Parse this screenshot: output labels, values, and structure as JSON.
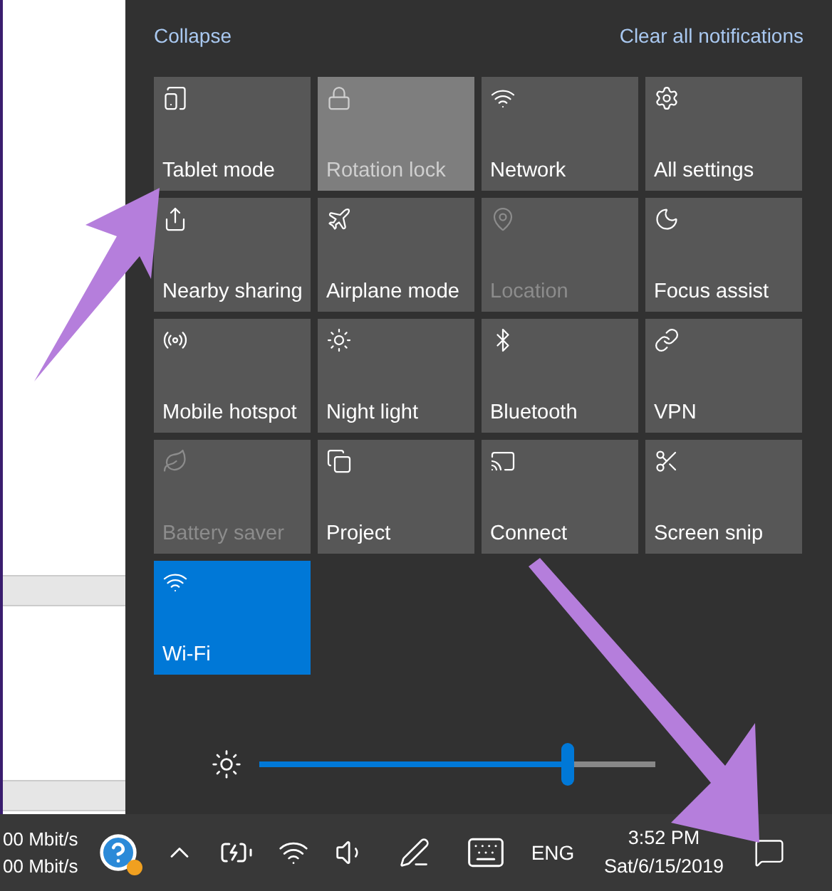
{
  "header": {
    "collapse": "Collapse",
    "clear_all": "Clear all notifications"
  },
  "tiles": [
    {
      "label": "Tablet mode",
      "on": false,
      "disabled": false,
      "hovered": false
    },
    {
      "label": "Rotation lock",
      "on": false,
      "disabled": true,
      "hovered": true
    },
    {
      "label": "Network",
      "on": false,
      "disabled": false,
      "hovered": false
    },
    {
      "label": "All settings",
      "on": false,
      "disabled": false,
      "hovered": false
    },
    {
      "label": "Nearby sharing",
      "on": false,
      "disabled": false,
      "hovered": false
    },
    {
      "label": "Airplane mode",
      "on": false,
      "disabled": false,
      "hovered": false
    },
    {
      "label": "Location",
      "on": false,
      "disabled": true,
      "hovered": false
    },
    {
      "label": "Focus assist",
      "on": false,
      "disabled": false,
      "hovered": false
    },
    {
      "label": "Mobile hotspot",
      "on": false,
      "disabled": false,
      "hovered": false
    },
    {
      "label": "Night light",
      "on": false,
      "disabled": false,
      "hovered": false
    },
    {
      "label": "Bluetooth",
      "on": false,
      "disabled": false,
      "hovered": false
    },
    {
      "label": "VPN",
      "on": false,
      "disabled": false,
      "hovered": false
    },
    {
      "label": "Battery saver",
      "on": false,
      "disabled": true,
      "hovered": false
    },
    {
      "label": "Project",
      "on": false,
      "disabled": false,
      "hovered": false
    },
    {
      "label": "Connect",
      "on": false,
      "disabled": false,
      "hovered": false
    },
    {
      "label": "Screen snip",
      "on": false,
      "disabled": false,
      "hovered": false
    },
    {
      "label": "Wi-Fi",
      "on": true,
      "disabled": false,
      "hovered": false
    }
  ],
  "brightness": {
    "level": 0.78
  },
  "taskbar": {
    "net_speed": [
      "00 Mbit/s",
      "00 Mbit/s"
    ],
    "language": "ENG",
    "time": "3:52 PM",
    "date": "Sat/6/15/2019"
  }
}
